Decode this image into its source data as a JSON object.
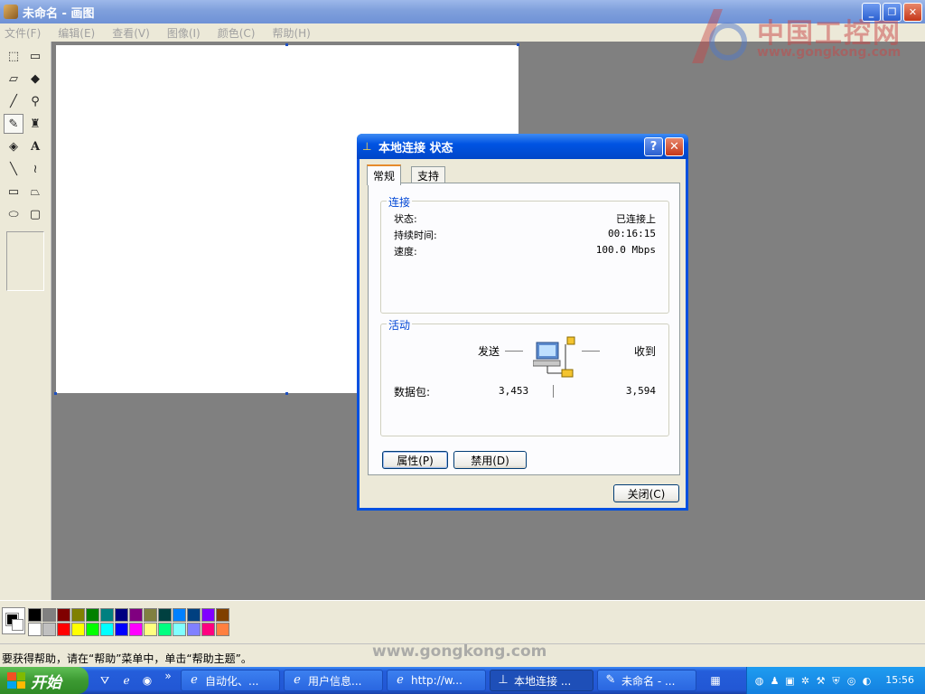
{
  "window": {
    "title": "未命名 - 画图",
    "min": "_",
    "max": "❐",
    "close": "✕"
  },
  "menu": [
    "文件(F)",
    "编辑(E)",
    "查看(V)",
    "图像(I)",
    "颜色(C)",
    "帮助(H)"
  ],
  "watermark": {
    "cn": "中国工控网",
    "url": "www.gongkong.com",
    "url2": "www.gongkong.com"
  },
  "tools": [
    "free-select-icon",
    "rect-select-icon",
    "eraser-icon",
    "fill-icon",
    "eyedropper-icon",
    "magnifier-icon",
    "pencil-icon",
    "brush-icon",
    "airbrush-icon",
    "text-icon",
    "line-icon",
    "curve-icon",
    "rectangle-icon",
    "polygon-icon",
    "ellipse-icon",
    "rounded-rect-icon"
  ],
  "palette": {
    "row1": [
      "#000000",
      "#808080",
      "#800000",
      "#808000",
      "#008000",
      "#008080",
      "#000080",
      "#800080",
      "#808040",
      "#004040",
      "#0080ff",
      "#004080",
      "#8000ff",
      "#804000"
    ],
    "row2": [
      "#ffffff",
      "#c0c0c0",
      "#ff0000",
      "#ffff00",
      "#00ff00",
      "#00ffff",
      "#0000ff",
      "#ff00ff",
      "#ffff80",
      "#00ff80",
      "#80ffff",
      "#8080ff",
      "#ff0080",
      "#ff8040"
    ]
  },
  "status": "要获得帮助，请在“帮助”菜单中，单击“帮助主题”。",
  "dialog": {
    "title": "本地连接 状态",
    "help": "?",
    "tabs": [
      "常规",
      "支持"
    ],
    "connection": {
      "legend": "连接",
      "status_label": "状态:",
      "status_value": "已连接上",
      "duration_label": "持续时间:",
      "duration_value": "00:16:15",
      "speed_label": "速度:",
      "speed_value": "100.0 Mbps"
    },
    "activity": {
      "legend": "活动",
      "sent_label": "发送",
      "received_label": "收到",
      "packets_label": "数据包:",
      "packets_sent": "3,453",
      "packets_received": "3,594"
    },
    "properties_button": "属性(P)",
    "disable_button": "禁用(D)",
    "close_button": "关闭(C)"
  },
  "taskbar": {
    "start": "开始",
    "items": [
      "自动化、...",
      "用户信息...",
      "http://w...",
      "本地连接 ...",
      "未命名 - ..."
    ],
    "clock": "15:56"
  }
}
